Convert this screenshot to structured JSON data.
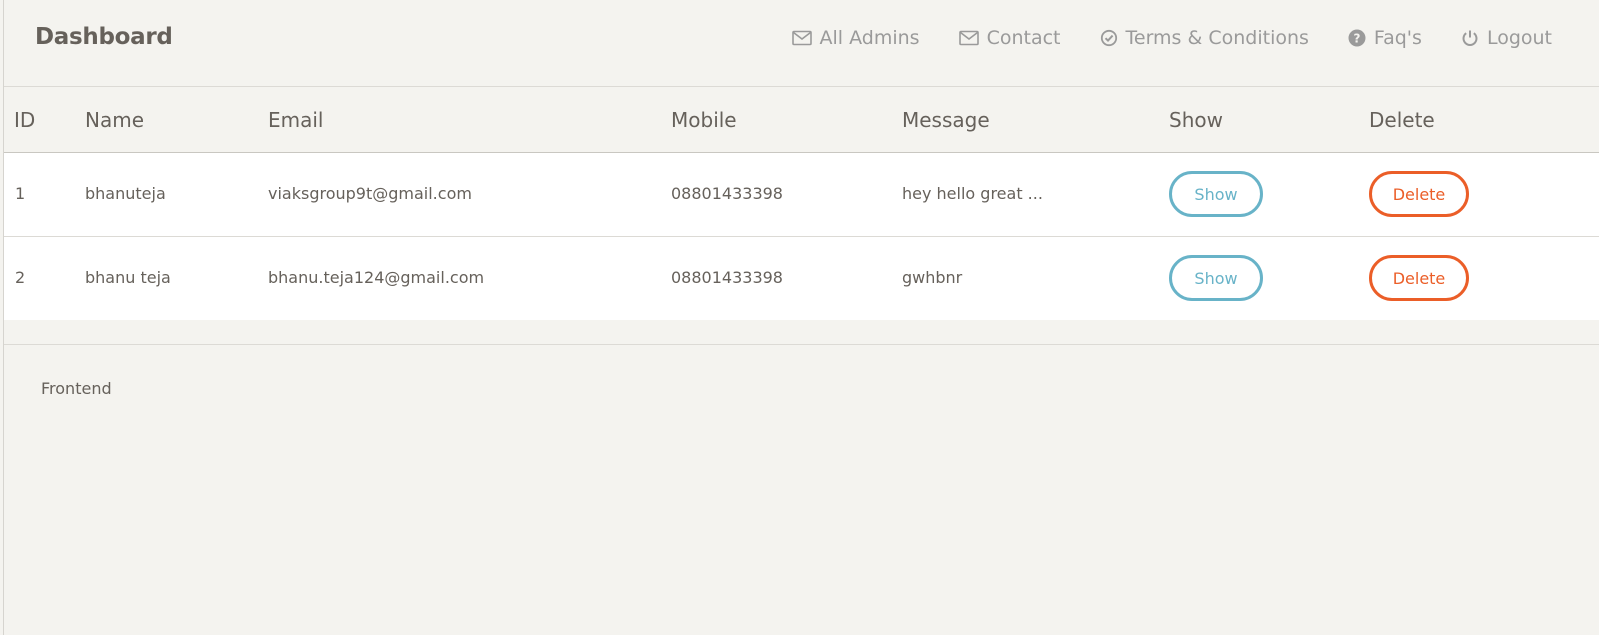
{
  "brand": "Dashboard",
  "nav": [
    {
      "label": "All Admins",
      "icon": "envelope-icon"
    },
    {
      "label": "Contact",
      "icon": "envelope-icon"
    },
    {
      "label": "Terms & Conditions",
      "icon": "check-circle-icon"
    },
    {
      "label": "Faq's",
      "icon": "question-circle-icon"
    },
    {
      "label": "Logout",
      "icon": "power-icon"
    }
  ],
  "table": {
    "headers": [
      "ID",
      "Name",
      "Email",
      "Mobile",
      "Message",
      "Show",
      "Delete"
    ],
    "rows": [
      {
        "id": "1",
        "name": "bhanuteja",
        "email": "viaksgroup9t@gmail.com",
        "mobile": "08801433398",
        "message": "hey hello great ...",
        "show": "Show",
        "delete": "Delete"
      },
      {
        "id": "2",
        "name": "bhanu teja",
        "email": "bhanu.teja124@gmail.com",
        "mobile": "08801433398",
        "message": "gwhbnr",
        "show": "Show",
        "delete": "Delete"
      }
    ]
  },
  "footer": {
    "link": "Frontend"
  },
  "colors": {
    "show": "#68b3c8",
    "delete": "#eb5e28",
    "background": "#f4f3ef"
  }
}
